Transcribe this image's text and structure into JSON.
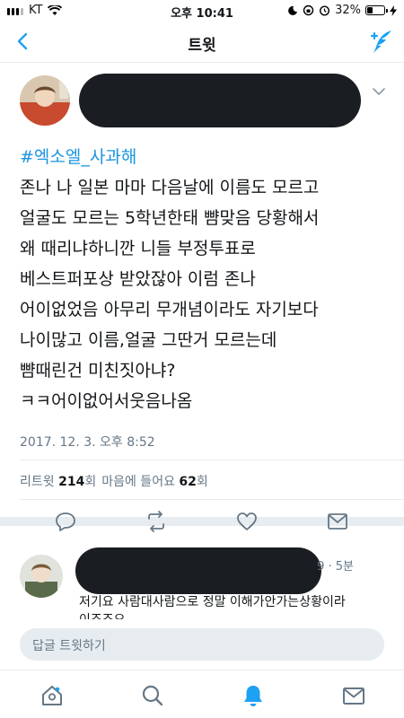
{
  "status_bar": {
    "carrier": "KT",
    "time": "오후 10:41",
    "battery": "32%",
    "battery_level": 0.32
  },
  "nav": {
    "title": "트윗",
    "back_icon": "chevron-left-icon",
    "compose_icon": "compose-tweet-icon"
  },
  "tweet": {
    "hashtag": "#엑소엘_사과해",
    "lines": [
      "존나 나 일본 마마 다음날에 이름도 모르고",
      "얼굴도 모르는 5학년한태 뺨맞음 당황해서",
      "왜 때리냐하니깐 니들 부정투표로",
      "베스트퍼포상 받았잖아 이럼 존나",
      "어이없었음 아무리 무개념이라도 자기보다",
      "나이많고 이름,얼굴 그딴거 모르는데",
      "뺨때린건 미친짓아냐?",
      "ㅋㅋ어이없어서웃음나옴"
    ],
    "date": "2017. 12. 3. 오후 8:52",
    "retweet_label": "리트윗",
    "retweet_count": "214",
    "retweet_unit": "회",
    "like_label": "마음에 들어요",
    "like_count": "62",
    "like_unit": "회"
  },
  "reply": {
    "meta": "9 · 5분",
    "text_line1": "저기요 사람대사람으로 정말 이해가안가는상황이라",
    "text_line2": "이죠죠요"
  },
  "reply_input": {
    "placeholder": "답글 트윗하기"
  },
  "colors": {
    "accent": "#1da1f2",
    "hashtag": "#1b95e0",
    "muted": "#657786",
    "divider": "#e6ecf0"
  }
}
